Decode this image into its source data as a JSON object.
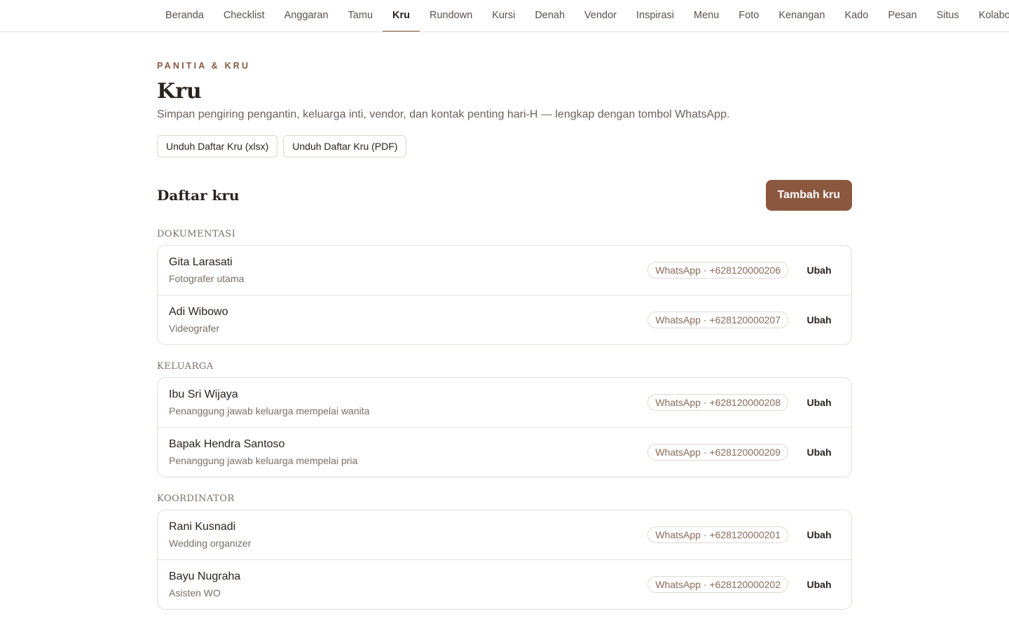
{
  "nav": {
    "tabs": [
      "Beranda",
      "Checklist",
      "Anggaran",
      "Tamu",
      "Kru",
      "Rundown",
      "Kursi",
      "Denah",
      "Vendor",
      "Inspirasi",
      "Menu",
      "Foto",
      "Kenangan",
      "Kado",
      "Pesan",
      "Situs",
      "Kolaborasi"
    ],
    "active": "Kru"
  },
  "header": {
    "eyebrow": "PANITIA & KRU",
    "title": "Kru",
    "subtitle": "Simpan pengiring pengantin, keluarga inti, vendor, dan kontak penting hari-H — lengkap dengan tombol WhatsApp."
  },
  "exports": {
    "xlsx_label": "Unduh Daftar Kru (xlsx)",
    "pdf_label": "Unduh Daftar Kru (PDF)"
  },
  "list": {
    "title": "Daftar kru",
    "add_label": "Tambah kru",
    "edit_label": "Ubah",
    "groups": [
      {
        "label": "DOKUMENTASI",
        "members": [
          {
            "name": "Gita Larasati",
            "role": "Fotografer utama",
            "whatsapp": "WhatsApp · +628120000206"
          },
          {
            "name": "Adi Wibowo",
            "role": "Videografer",
            "whatsapp": "WhatsApp · +628120000207"
          }
        ]
      },
      {
        "label": "KELUARGA",
        "members": [
          {
            "name": "Ibu Sri Wijaya",
            "role": "Penanggung jawab keluarga mempelai wanita",
            "whatsapp": "WhatsApp · +628120000208"
          },
          {
            "name": "Bapak Hendra Santoso",
            "role": "Penanggung jawab keluarga mempelai pria",
            "whatsapp": "WhatsApp · +628120000209"
          }
        ]
      },
      {
        "label": "KOORDINATOR",
        "members": [
          {
            "name": "Rani Kusnadi",
            "role": "Wedding organizer",
            "whatsapp": "WhatsApp · +628120000201"
          },
          {
            "name": "Bayu Nugraha",
            "role": "Asisten WO",
            "whatsapp": "WhatsApp · +628120000202"
          }
        ]
      }
    ]
  },
  "colors": {
    "accent": "#8b573e",
    "border": "#e4dfdb",
    "muted_text": "#7a6e66"
  }
}
